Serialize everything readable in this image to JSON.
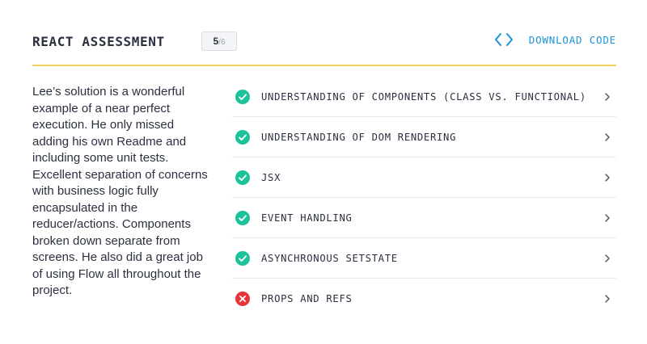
{
  "header": {
    "title": "REACT ASSESSMENT",
    "score": {
      "value": "5",
      "total": "/6"
    },
    "download_label": "DOWNLOAD CODE",
    "download_icon": "code-brackets-icon"
  },
  "colors": {
    "accent": "#1a94d6",
    "divider": "#f3d35c",
    "pass": "#1cc29a",
    "fail": "#e8353b"
  },
  "summary": "Lee’s solution is a wonderful example of a near perfect execution. He only missed adding his own Readme and including some unit tests. Excellent separation of concerns with business logic fully encapsulated in the reducer/actions. Components broken down separate from screens. He also did a great job of using Flow all throughout the project.",
  "criteria": [
    {
      "label": "UNDERSTANDING OF COMPONENTS (CLASS VS. FUNCTIONAL)",
      "status": "pass",
      "icon": "check-circle-icon"
    },
    {
      "label": "UNDERSTANDING OF DOM RENDERING",
      "status": "pass",
      "icon": "check-circle-icon"
    },
    {
      "label": "JSX",
      "status": "pass",
      "icon": "check-circle-icon"
    },
    {
      "label": "EVENT HANDLING",
      "status": "pass",
      "icon": "check-circle-icon"
    },
    {
      "label": "ASYNCHRONOUS SETSTATE",
      "status": "pass",
      "icon": "check-circle-icon"
    },
    {
      "label": "PROPS AND REFS",
      "status": "fail",
      "icon": "x-circle-icon"
    }
  ]
}
